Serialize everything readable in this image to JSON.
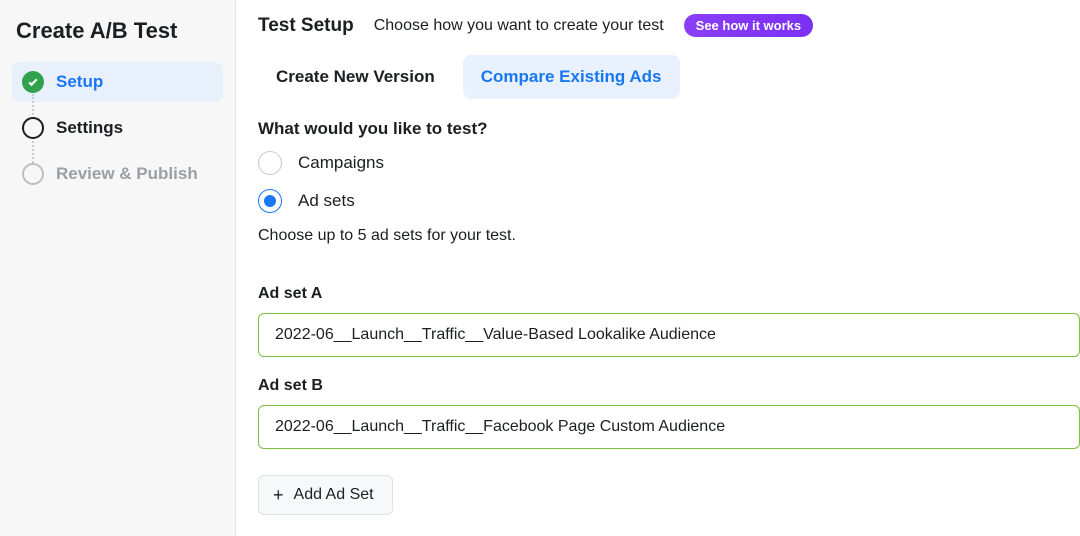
{
  "sidebar": {
    "title": "Create A/B Test",
    "steps": [
      {
        "label": "Setup",
        "state": "active"
      },
      {
        "label": "Settings",
        "state": "pending"
      },
      {
        "label": "Review & Publish",
        "state": "disabled"
      }
    ]
  },
  "header": {
    "title": "Test Setup",
    "subtitle": "Choose how you want to create your test",
    "help_pill": "See how it works"
  },
  "tabs": [
    {
      "label": "Create New Version",
      "selected": false
    },
    {
      "label": "Compare Existing Ads",
      "selected": true
    }
  ],
  "test_scope": {
    "question": "What would you like to test?",
    "options": [
      {
        "label": "Campaigns",
        "selected": false
      },
      {
        "label": "Ad sets",
        "selected": true
      }
    ],
    "hint": "Choose up to 5 ad sets for your test."
  },
  "ad_sets": [
    {
      "label": "Ad set A",
      "value": "2022-06__Launch__Traffic__Value-Based Lookalike Audience"
    },
    {
      "label": "Ad set B",
      "value": "2022-06__Launch__Traffic__Facebook Page Custom Audience"
    }
  ],
  "add_button": "Add Ad Set"
}
